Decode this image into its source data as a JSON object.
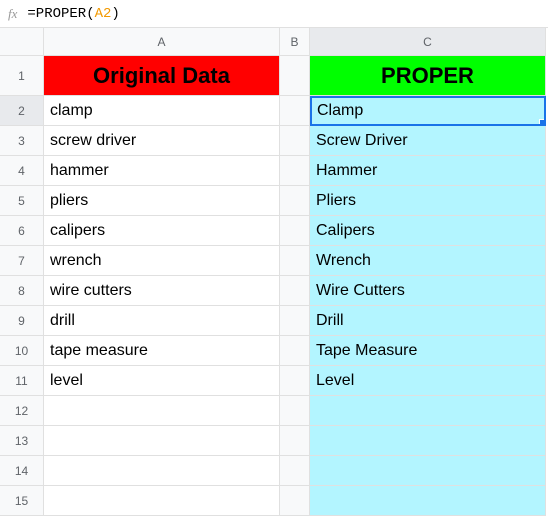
{
  "formula_bar": {
    "fx": "fx",
    "prefix": "=PROPER(",
    "cellref": "A2",
    "suffix": ")"
  },
  "columns": {
    "a": "A",
    "b": "B",
    "c": "C"
  },
  "rows": [
    "1",
    "2",
    "3",
    "4",
    "5",
    "6",
    "7",
    "8",
    "9",
    "10",
    "11",
    "12",
    "13",
    "14",
    "15"
  ],
  "headers": {
    "a": "Original Data",
    "c": "PROPER"
  },
  "data": {
    "a": [
      "clamp",
      "screw driver",
      "hammer",
      "pliers",
      "calipers",
      "wrench",
      "wire cutters",
      "drill",
      "tape measure",
      "level",
      "",
      "",
      "",
      ""
    ],
    "c": [
      "Clamp",
      "Screw Driver",
      "Hammer",
      "Pliers",
      "Calipers",
      "Wrench",
      "Wire Cutters",
      "Drill",
      "Tape Measure",
      "Level",
      "",
      "",
      "",
      ""
    ]
  },
  "chart_data": {
    "type": "table",
    "columns": [
      "Original Data",
      "PROPER"
    ],
    "rows": [
      [
        "clamp",
        "Clamp"
      ],
      [
        "screw driver",
        "Screw Driver"
      ],
      [
        "hammer",
        "Hammer"
      ],
      [
        "pliers",
        "Pliers"
      ],
      [
        "calipers",
        "Calipers"
      ],
      [
        "wrench",
        "Wrench"
      ],
      [
        "wire cutters",
        "Wire Cutters"
      ],
      [
        "drill",
        "Drill"
      ],
      [
        "tape measure",
        "Tape Measure"
      ],
      [
        "level",
        "Level"
      ]
    ],
    "selected_cell": "C2",
    "formula": "=PROPER(A2)"
  }
}
